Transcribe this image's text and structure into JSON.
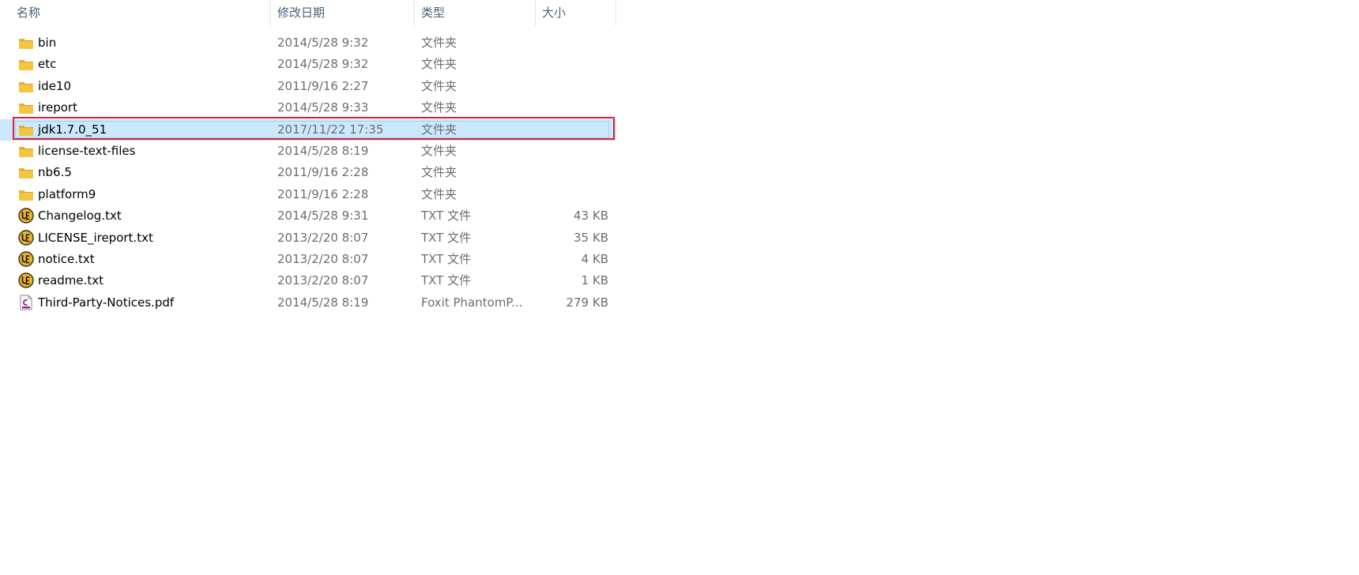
{
  "columns": {
    "name": "名称",
    "date": "修改日期",
    "type": "类型",
    "size": "大小"
  },
  "sort_indicator": "^",
  "colors": {
    "folder": "#f5c440",
    "folder_dark": "#dca628",
    "selection_bg": "#cce8ff",
    "highlight_border": "#e0202a",
    "ue_icon": "#e9b52a"
  },
  "files": [
    {
      "name": "bin",
      "date": "2014/5/28 9:32",
      "type": "文件夹",
      "size": "",
      "icon": "folder-icon"
    },
    {
      "name": "etc",
      "date": "2014/5/28 9:32",
      "type": "文件夹",
      "size": "",
      "icon": "folder-icon"
    },
    {
      "name": "ide10",
      "date": "2011/9/16 2:27",
      "type": "文件夹",
      "size": "",
      "icon": "folder-icon"
    },
    {
      "name": "ireport",
      "date": "2014/5/28 9:33",
      "type": "文件夹",
      "size": "",
      "icon": "folder-icon"
    },
    {
      "name": "jdk1.7.0_51",
      "date": "2017/11/22 17:35",
      "type": "文件夹",
      "size": "",
      "icon": "folder-icon",
      "selected": true
    },
    {
      "name": "license-text-files",
      "date": "2014/5/28 8:19",
      "type": "文件夹",
      "size": "",
      "icon": "folder-icon"
    },
    {
      "name": "nb6.5",
      "date": "2011/9/16 2:28",
      "type": "文件夹",
      "size": "",
      "icon": "folder-icon"
    },
    {
      "name": "platform9",
      "date": "2011/9/16 2:28",
      "type": "文件夹",
      "size": "",
      "icon": "folder-icon"
    },
    {
      "name": "Changelog.txt",
      "date": "2014/5/28 9:31",
      "type": "TXT 文件",
      "size": "43 KB",
      "icon": "ultraedit-icon"
    },
    {
      "name": "LICENSE_ireport.txt",
      "date": "2013/2/20 8:07",
      "type": "TXT 文件",
      "size": "35 KB",
      "icon": "ultraedit-icon"
    },
    {
      "name": "notice.txt",
      "date": "2013/2/20 8:07",
      "type": "TXT 文件",
      "size": "4 KB",
      "icon": "ultraedit-icon"
    },
    {
      "name": "readme.txt",
      "date": "2013/2/20 8:07",
      "type": "TXT 文件",
      "size": "1 KB",
      "icon": "ultraedit-icon"
    },
    {
      "name": "Third-Party-Notices.pdf",
      "date": "2014/5/28 8:19",
      "type": "Foxit PhantomP...",
      "size": "279 KB",
      "icon": "pdf-icon"
    }
  ]
}
